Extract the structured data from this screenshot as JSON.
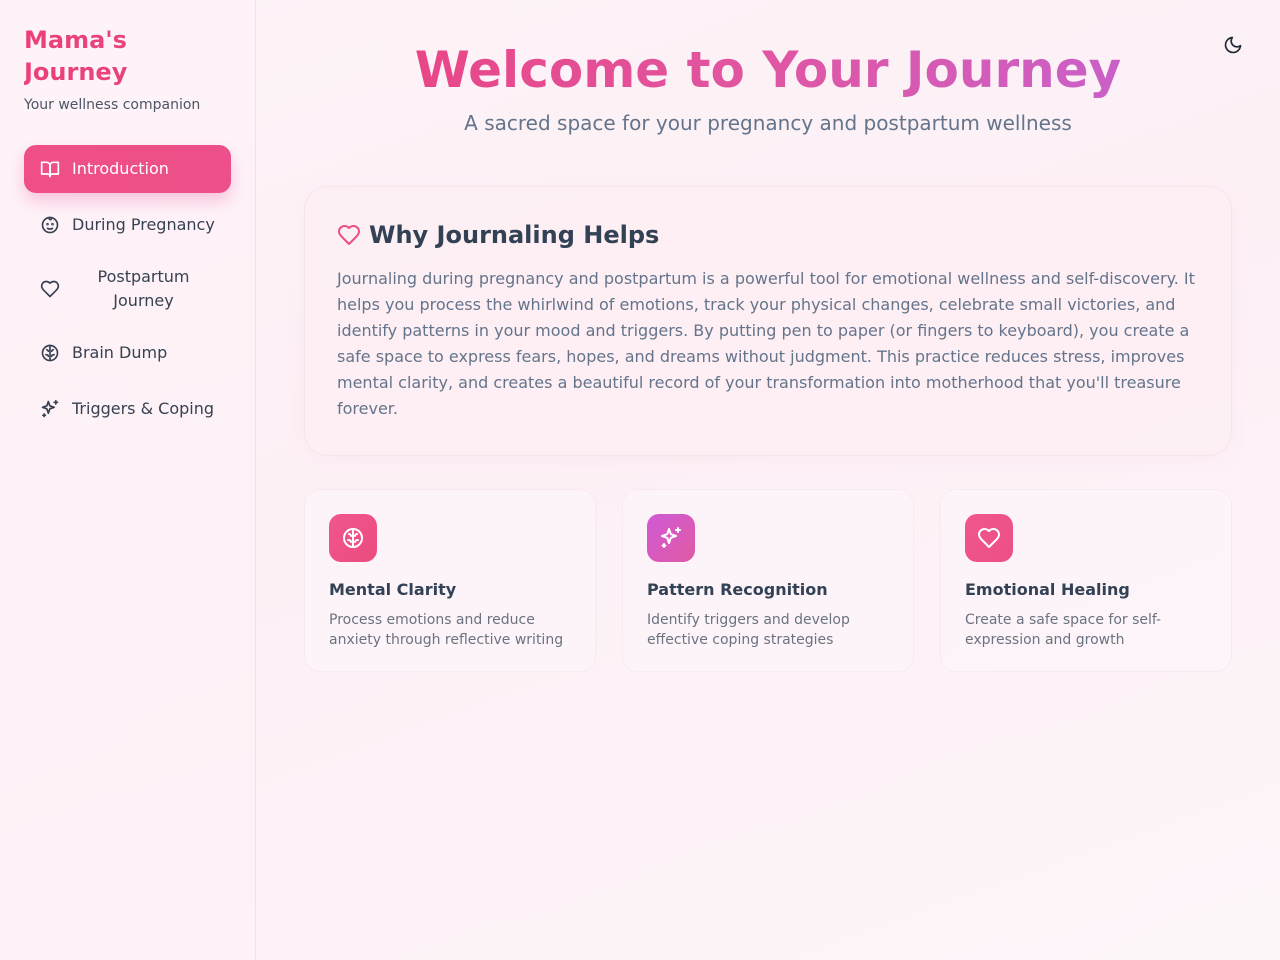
{
  "sidebar": {
    "brand": "Mama's\nJourney",
    "brand_line1": "Mama's",
    "brand_line2": "Journey",
    "tagline": "Your wellness companion",
    "items": [
      {
        "label": "Introduction",
        "icon": "book-open-icon",
        "active": true
      },
      {
        "label": "During Pregnancy",
        "icon": "baby-face-icon",
        "active": false
      },
      {
        "label": "Postpartum Journey",
        "icon": "heart-icon",
        "active": false
      },
      {
        "label": "Brain Dump",
        "icon": "brain-icon",
        "active": false
      },
      {
        "label": "Triggers & Coping",
        "icon": "sparkles-icon",
        "active": false
      }
    ]
  },
  "header": {
    "theme_toggle_icon": "moon-icon",
    "title": "Welcome to Your Journey",
    "subtitle": "A sacred space for your pregnancy and postpartum wellness"
  },
  "why": {
    "icon": "heart-icon",
    "title": "Why Journaling Helps",
    "body": "Journaling during pregnancy and postpartum is a powerful tool for emotional wellness and self-discovery. It helps you process the whirlwind of emotions, track your physical changes, celebrate small victories, and identify patterns in your mood and triggers. By putting pen to paper (or fingers to keyboard), you create a safe space to express fears, hopes, and dreams without judgment. This practice reduces stress, improves mental clarity, and creates a beautiful record of your transformation into motherhood that you'll treasure forever."
  },
  "features": [
    {
      "icon": "brain-icon",
      "title": "Mental Clarity",
      "desc": "Process emotions and reduce anxiety through reflective writing"
    },
    {
      "icon": "sparkles-icon",
      "title": "Pattern Recognition",
      "desc": "Identify triggers and develop effective coping strategies"
    },
    {
      "icon": "heart-icon",
      "title": "Emotional Healing",
      "desc": "Create a safe space for self-expression and growth"
    }
  ],
  "colors": {
    "accent": "#ec4f86",
    "accent_purple": "#c064d8",
    "text": "#334155",
    "muted": "#64748b"
  }
}
